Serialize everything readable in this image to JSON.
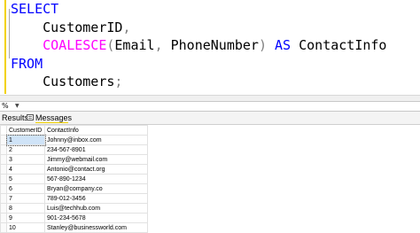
{
  "editor": {
    "code_lines": [
      [
        {
          "t": "SELECT",
          "k": "kw"
        }
      ],
      [
        {
          "t": "    CustomerID",
          "k": "id"
        },
        {
          "t": ",",
          "k": "op"
        }
      ],
      [
        {
          "t": "    ",
          "k": "id"
        },
        {
          "t": "COALESCE",
          "k": "fn"
        },
        {
          "t": "(",
          "k": "op"
        },
        {
          "t": "Email",
          "k": "id"
        },
        {
          "t": ",",
          "k": "op"
        },
        {
          "t": " PhoneNumber",
          "k": "id"
        },
        {
          "t": ")",
          "k": "op"
        },
        {
          "t": " ",
          "k": "id"
        },
        {
          "t": "AS",
          "k": "kw"
        },
        {
          "t": " ContactInfo",
          "k": "id"
        }
      ],
      [
        {
          "t": "FROM",
          "k": "kw"
        }
      ],
      [
        {
          "t": "    Customers",
          "k": "id"
        },
        {
          "t": ";",
          "k": "op"
        }
      ]
    ]
  },
  "zoom": {
    "value": "%"
  },
  "tabs": {
    "results": "Results",
    "messages": "Messages"
  },
  "grid": {
    "columns": [
      "CustomerID",
      "ContactInfo"
    ],
    "rows": [
      [
        "1",
        "Johnny@inbox.com"
      ],
      [
        "2",
        "234-567-8901"
      ],
      [
        "3",
        "Jimmy@webmail.com"
      ],
      [
        "4",
        "Antonio@contact.org"
      ],
      [
        "5",
        "567-890-1234"
      ],
      [
        "6",
        "Bryan@company.co"
      ],
      [
        "7",
        "789-012-3456"
      ],
      [
        "8",
        "Luis@techhub.com"
      ],
      [
        "9",
        "901-234-5678"
      ],
      [
        "10",
        "Stanley@businessworld.com"
      ]
    ]
  },
  "colors": {
    "keyword": "#0000ff",
    "function": "#ff00ff",
    "operator": "#808080",
    "accent": "#f2d200"
  }
}
